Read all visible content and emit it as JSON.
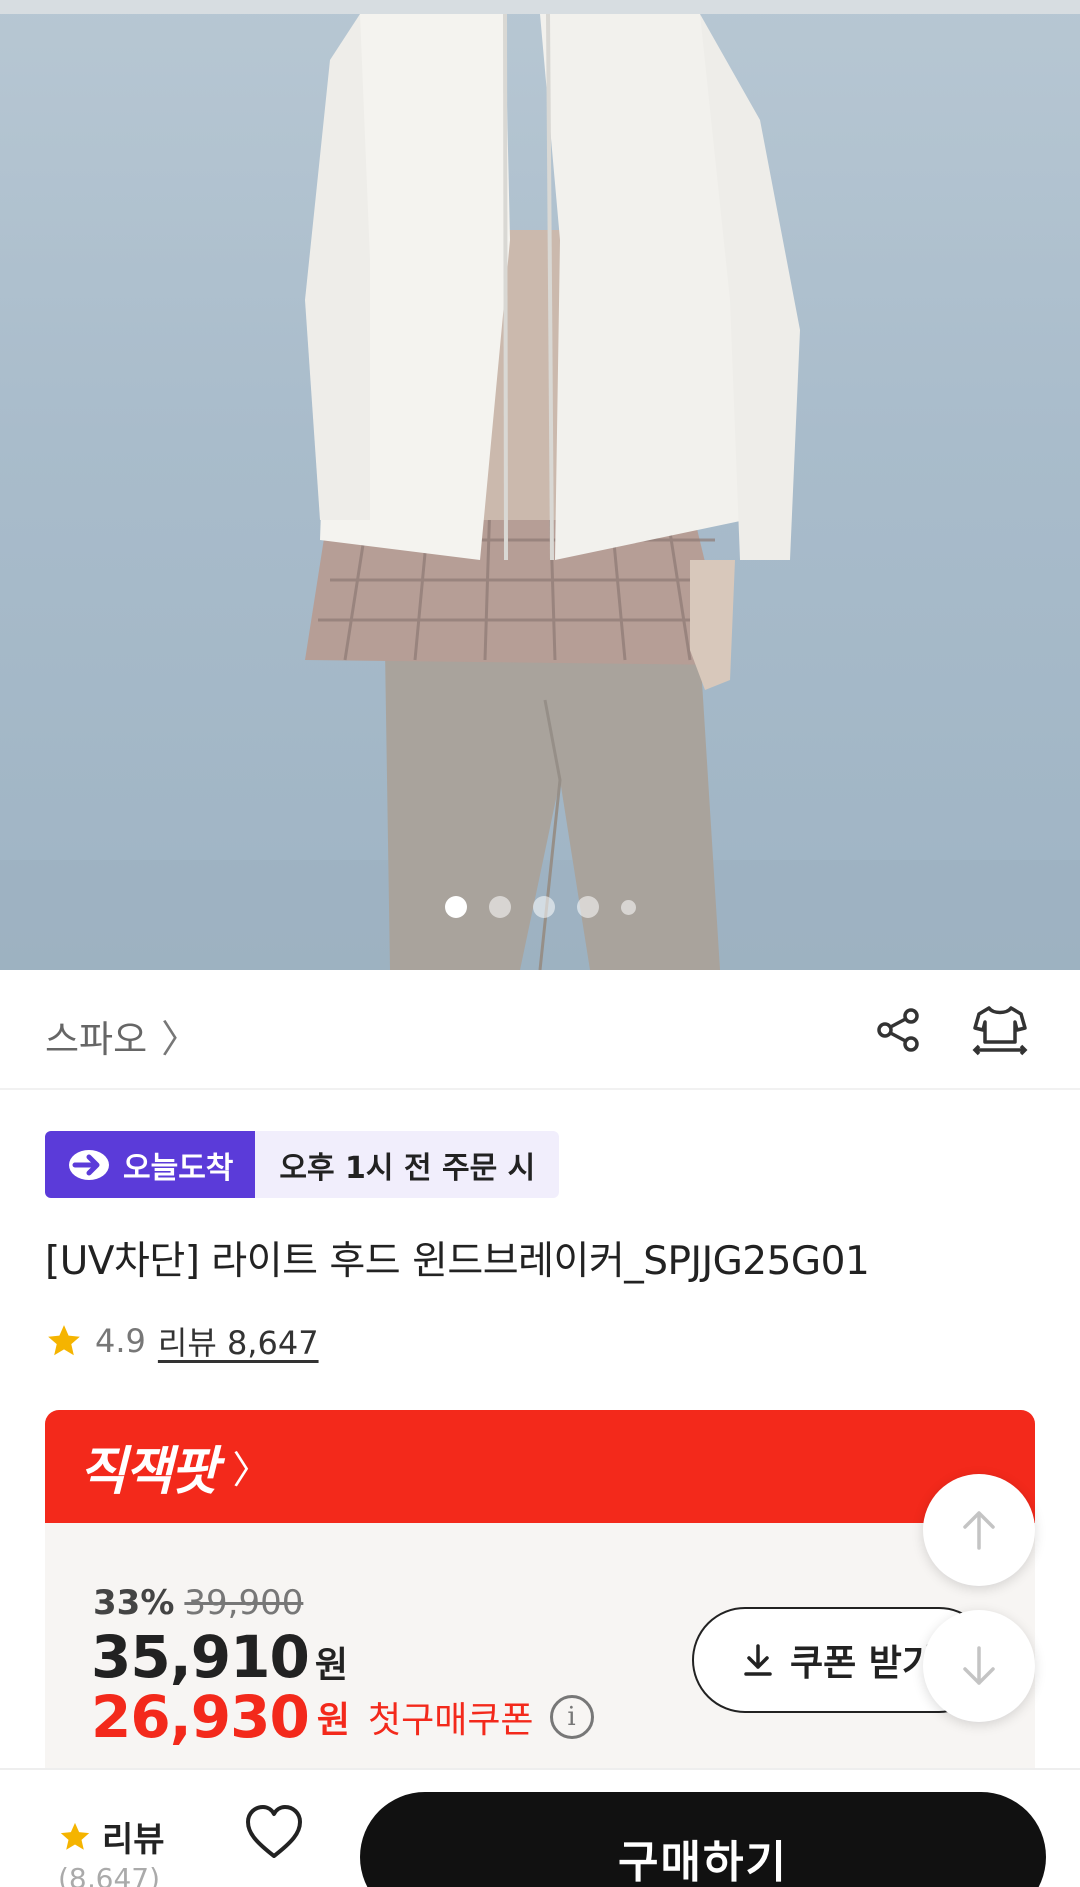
{
  "gallery": {
    "dots_total": 5,
    "active_index": 0
  },
  "brand": {
    "name": "스파오",
    "chevron": "〉"
  },
  "icons": {
    "share": "share-icon",
    "fitting": "try-on-icon",
    "star": "star-icon",
    "info": "i",
    "download": "download-icon",
    "heart": "heart-icon",
    "arrow_up": "arrow-up-icon",
    "arrow_down": "arrow-down-icon"
  },
  "delivery": {
    "badge_label": "오늘도착",
    "condition": "오후 1시 전 주문 시"
  },
  "product": {
    "title": "[UV차단] 라이트 후드 윈드브레이커_SPJJG25G01",
    "rating": "4.9",
    "review_link": "리뷰 8,647"
  },
  "deal": {
    "label": "직잭팟",
    "chevron": "〉",
    "discount_pct": "33%",
    "original_price": "39,900",
    "price": "35,910",
    "price_unit": "원",
    "coupon_price": "26,930",
    "coupon_unit": "원",
    "coupon_label": "첫구매쿠폰",
    "coupon_button": "쿠폰 받기"
  },
  "bottom_bar": {
    "review_label": "리뷰",
    "review_count": "(8,647)",
    "buy_button": "구매하기"
  },
  "colors": {
    "accent_red": "#f3291b",
    "badge_purple": "#5b3bd9",
    "star_yellow": "#f5b400",
    "buy_black": "#111111"
  }
}
